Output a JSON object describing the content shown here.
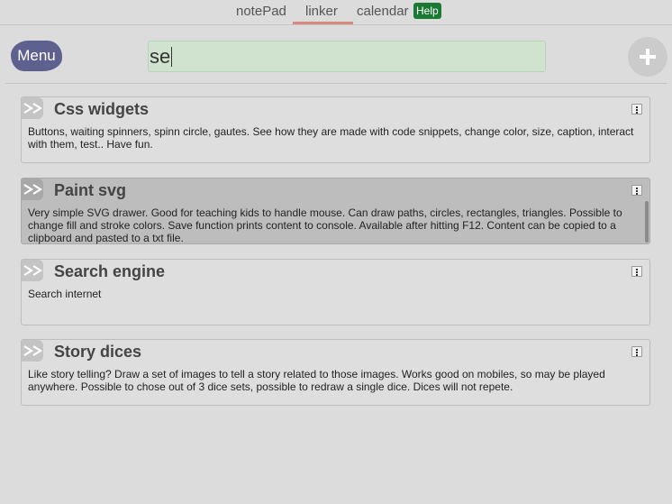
{
  "tabs": [
    {
      "label": "notePad"
    },
    {
      "label": "linker"
    },
    {
      "label": "calendar"
    }
  ],
  "help_label": "Help",
  "menu_label": "Menu",
  "search": {
    "value": "se"
  },
  "icons": {
    "add": "plus-icon",
    "card": "double-chevron-right-icon",
    "more": "kebab-menu-icon"
  },
  "colors": {
    "accent_tab": "#d98a80",
    "menu": "#5e6190",
    "help": "#1a7a34",
    "search_bg": "#cfe3cf"
  },
  "cards": [
    {
      "title": "Css widgets",
      "description": "Buttons, waiting spinners, spinn circle, gautes. See how they are made with code snippets, change color, size, caption, interact with them, test.. Have fun."
    },
    {
      "title": "Paint svg",
      "description": "Very simple SVG drawer. Good for teaching kids to handle mouse. Can draw paths, circles, rectangles, triangles. Possible to change fill and stroke colors. Save function prints content to console. Available after hitting F12. Content can be copied to a clipboard and pasted to a txt file."
    },
    {
      "title": "Search engine",
      "description": "Search internet"
    },
    {
      "title": "Story dices",
      "description": "Like story telling? Draw a set of images to tell a story related to those images. Works good on mobiles, so may be played anywhere. Possible to chose out of 3 dice sets, possible to redraw a single dice. Dices will not repete."
    }
  ]
}
